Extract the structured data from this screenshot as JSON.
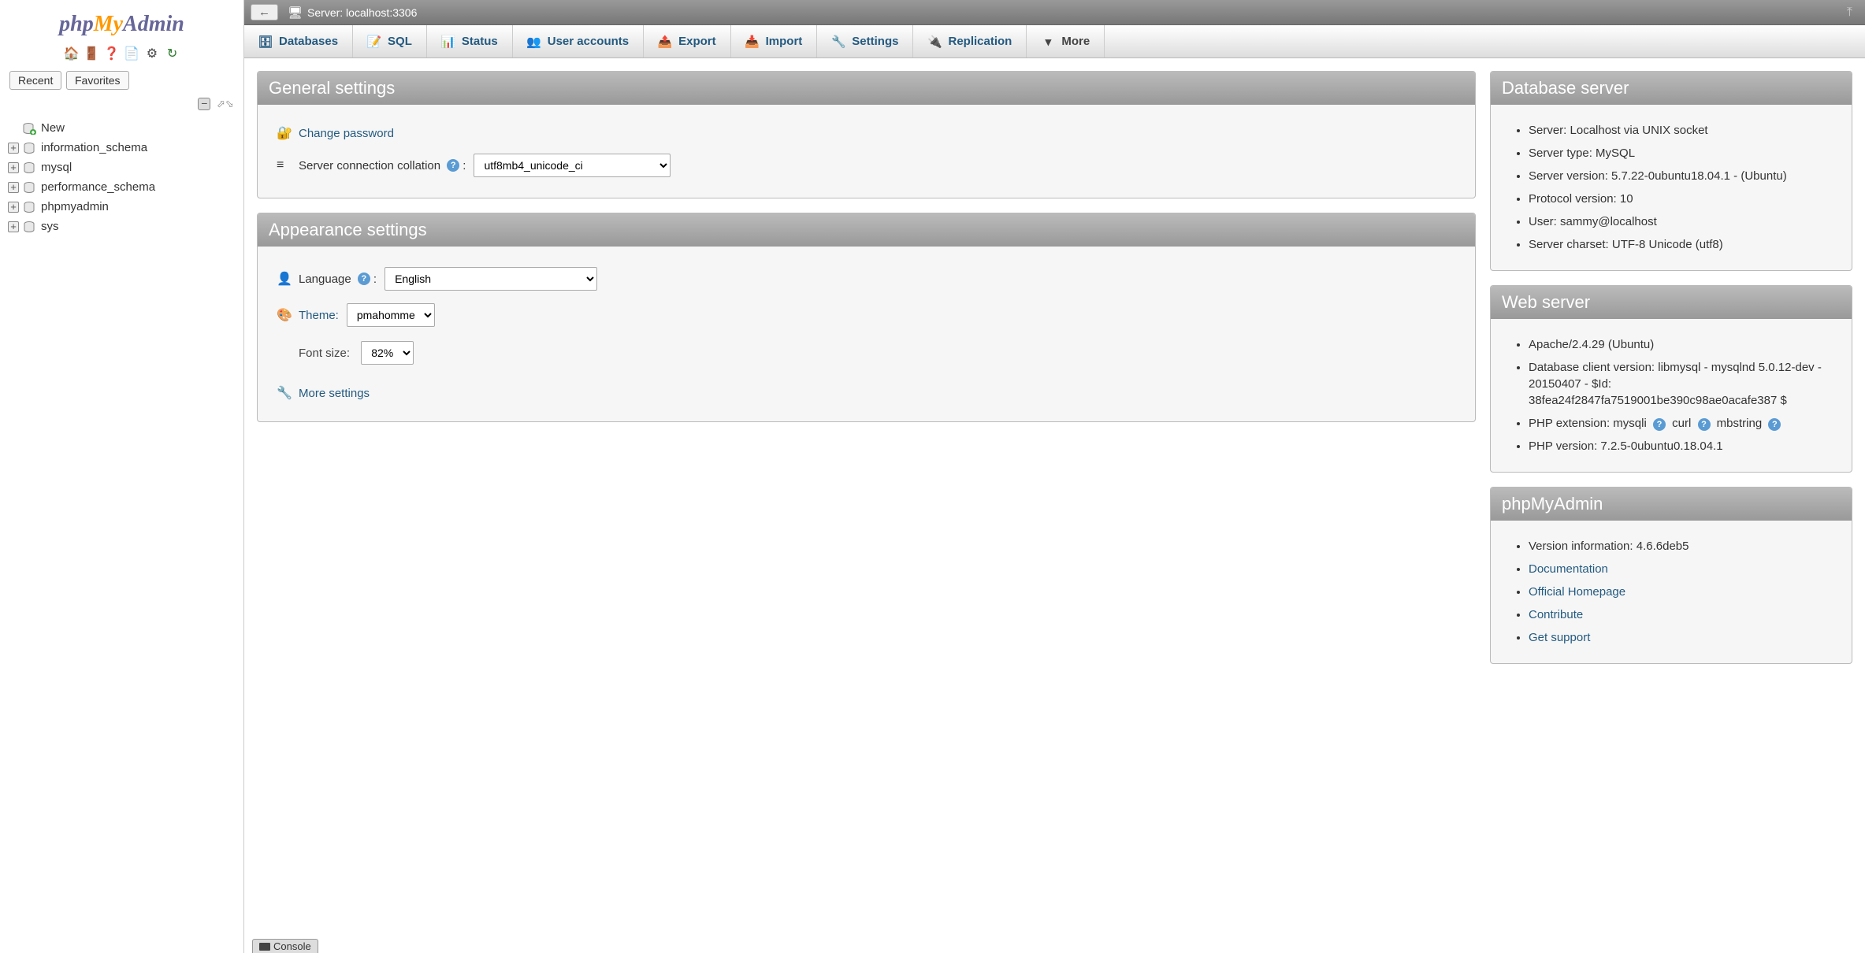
{
  "logo": {
    "php": "php",
    "my": "My",
    "admin": "Admin"
  },
  "sidebar": {
    "tabs": {
      "recent": "Recent",
      "favorites": "Favorites"
    },
    "new_label": "New",
    "databases": [
      "information_schema",
      "mysql",
      "performance_schema",
      "phpmyadmin",
      "sys"
    ]
  },
  "topbar": {
    "server_label": "Server: localhost:3306"
  },
  "menu": {
    "databases": "Databases",
    "sql": "SQL",
    "status": "Status",
    "users": "User accounts",
    "export": "Export",
    "import": "Import",
    "settings": "Settings",
    "replication": "Replication",
    "more": "More"
  },
  "general": {
    "title": "General settings",
    "change_password": "Change password",
    "collation_label": "Server connection collation",
    "collation_value": "utf8mb4_unicode_ci"
  },
  "appearance": {
    "title": "Appearance settings",
    "language_label": "Language",
    "language_value": "English",
    "theme_label": "Theme:",
    "theme_value": "pmahomme",
    "fontsize_label": "Font size:",
    "fontsize_value": "82%",
    "more_settings": "More settings"
  },
  "db_server": {
    "title": "Database server",
    "items": [
      "Server: Localhost via UNIX socket",
      "Server type: MySQL",
      "Server version: 5.7.22-0ubuntu18.04.1 - (Ubuntu)",
      "Protocol version: 10",
      "User: sammy@localhost",
      "Server charset: UTF-8 Unicode (utf8)"
    ]
  },
  "web_server": {
    "title": "Web server",
    "apache": "Apache/2.4.29 (Ubuntu)",
    "client": "Database client version: libmysql - mysqlnd 5.0.12-dev - 20150407 - $Id: 38fea24f2847fa7519001be390c98ae0acafe387 $",
    "ext_label": "PHP extension: ",
    "ext1": "mysqli",
    "ext2": "curl",
    "ext3": "mbstring",
    "php_version": "PHP version: 7.2.5-0ubuntu0.18.04.1"
  },
  "pma": {
    "title": "phpMyAdmin",
    "version": "Version information: 4.6.6deb5",
    "links": [
      "Documentation",
      "Official Homepage",
      "Contribute",
      "Get support"
    ]
  },
  "console": "Console"
}
